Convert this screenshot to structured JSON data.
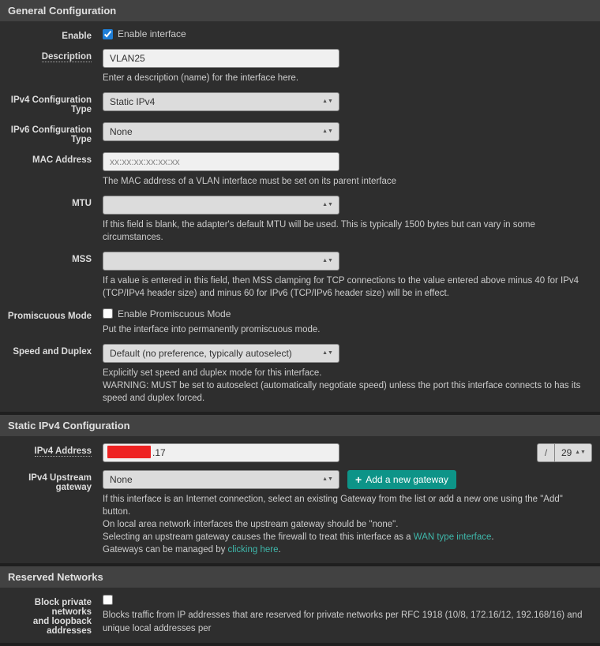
{
  "general": {
    "title": "General Configuration",
    "enable": {
      "label": "Enable",
      "text": "Enable interface",
      "checked": true
    },
    "description": {
      "label": "Description",
      "value": "VLAN25",
      "help": "Enter a description (name) for the interface here."
    },
    "ipv4type": {
      "label": "IPv4 Configuration Type",
      "value": "Static IPv4"
    },
    "ipv6type": {
      "label": "IPv6 Configuration Type",
      "value": "None"
    },
    "mac": {
      "label": "MAC Address",
      "placeholder": "xx:xx:xx:xx:xx:xx",
      "help": "The MAC address of a VLAN interface must be set on its parent interface"
    },
    "mtu": {
      "label": "MTU",
      "help": "If this field is blank, the adapter's default MTU will be used. This is typically 1500 bytes but can vary in some circumstances."
    },
    "mss": {
      "label": "MSS",
      "help": "If a value is entered in this field, then MSS clamping for TCP connections to the value entered above minus 40 for IPv4 (TCP/IPv4 header size) and minus 60 for IPv6 (TCP/IPv6 header size) will be in effect."
    },
    "promisc": {
      "label": "Promiscuous Mode",
      "text": "Enable Promiscuous Mode",
      "help": "Put the interface into permanently promiscuous mode."
    },
    "speed": {
      "label": "Speed and Duplex",
      "value": "Default (no preference, typically autoselect)",
      "help1": "Explicitly set speed and duplex mode for this interface.",
      "help2": "WARNING: MUST be set to autoselect (automatically negotiate speed) unless the port this interface connects to has its speed and duplex forced."
    }
  },
  "staticipv4": {
    "title": "Static IPv4 Configuration",
    "addr": {
      "label": "IPv4 Address",
      "value_suffix": ".17",
      "cidr": "29"
    },
    "gateway": {
      "label": "IPv4 Upstream gateway",
      "value": "None",
      "btn": "Add a new gateway",
      "help1": "If this interface is an Internet connection, select an existing Gateway from the list or add a new one using the \"Add\" button.",
      "help2": "On local area network interfaces the upstream gateway should be \"none\".",
      "help3a": "Selecting an upstream gateway causes the firewall to treat this interface as a ",
      "help3b": "WAN type interface",
      "help4a": "Gateways can be managed by ",
      "help4b": "clicking here"
    }
  },
  "reserved": {
    "title": "Reserved Networks",
    "blockpriv": {
      "label1": "Block private networks",
      "label2": "and loopback addresses",
      "help": "Blocks traffic from IP addresses that are reserved for private networks per RFC 1918 (10/8, 172.16/12, 192.168/16) and unique local addresses per"
    }
  }
}
